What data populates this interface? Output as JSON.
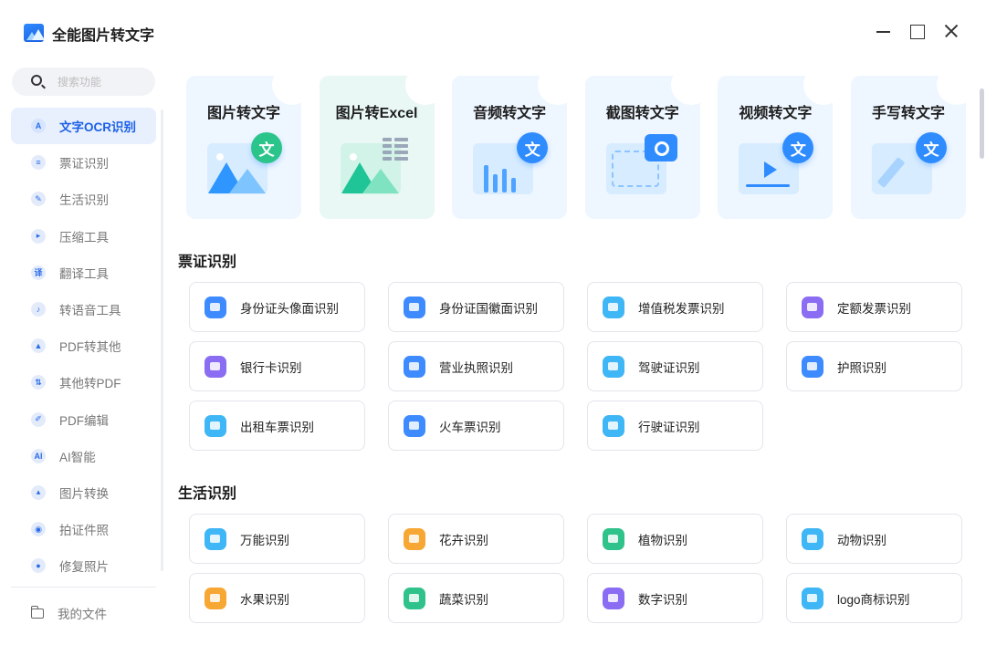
{
  "app": {
    "title": "全能图片转文字"
  },
  "search": {
    "placeholder": "搜索功能"
  },
  "sidebar": {
    "items": [
      {
        "label": "文字OCR识别",
        "icon": "A",
        "active": true
      },
      {
        "label": "票证识别",
        "icon": "≡"
      },
      {
        "label": "生活识别",
        "icon": "✎"
      },
      {
        "label": "压缩工具",
        "icon": "▸"
      },
      {
        "label": "翻译工具",
        "icon": "译"
      },
      {
        "label": "转语音工具",
        "icon": "♪"
      },
      {
        "label": "PDF转其他",
        "icon": "▲"
      },
      {
        "label": "其他转PDF",
        "icon": "⇅"
      },
      {
        "label": "PDF编辑",
        "icon": "✐"
      },
      {
        "label": "AI智能",
        "icon": "AI"
      },
      {
        "label": "图片转换",
        "icon": "▴"
      },
      {
        "label": "拍证件照",
        "icon": "◉"
      },
      {
        "label": "修复照片",
        "icon": "●"
      }
    ],
    "my_files": "我的文件"
  },
  "big_cards": [
    {
      "title": "图片转文字",
      "badge": "文"
    },
    {
      "title": "图片转Excel"
    },
    {
      "title": "音频转文字",
      "badge": "文"
    },
    {
      "title": "截图转文字"
    },
    {
      "title": "视频转文字",
      "badge": "文"
    },
    {
      "title": "手写转文字",
      "badge": "文"
    }
  ],
  "sections": [
    {
      "title": "票证识别",
      "items": [
        {
          "label": "身份证头像面识别",
          "color": "#3d8bff"
        },
        {
          "label": "身份证国徽面识别",
          "color": "#3d8bff"
        },
        {
          "label": "增值税发票识别",
          "color": "#3fb6f5"
        },
        {
          "label": "定额发票识别",
          "color": "#8a6df2"
        },
        {
          "label": "银行卡识别",
          "color": "#8a6df2"
        },
        {
          "label": "营业执照识别",
          "color": "#3d8bff"
        },
        {
          "label": "驾驶证识别",
          "color": "#3fb6f5"
        },
        {
          "label": "护照识别",
          "color": "#3d8bff"
        },
        {
          "label": "出租车票识别",
          "color": "#3fb6f5"
        },
        {
          "label": "火车票识别",
          "color": "#3d8bff"
        },
        {
          "label": "行驶证识别",
          "color": "#3fb6f5"
        }
      ]
    },
    {
      "title": "生活识别",
      "items": [
        {
          "label": "万能识别",
          "color": "#3fb6f5"
        },
        {
          "label": "花卉识别",
          "color": "#f7a733"
        },
        {
          "label": "植物识别",
          "color": "#2fc28a"
        },
        {
          "label": "动物识别",
          "color": "#3fb6f5"
        },
        {
          "label": "水果识别",
          "color": "#f7a733"
        },
        {
          "label": "蔬菜识别",
          "color": "#2fc28a"
        },
        {
          "label": "数字识别",
          "color": "#8a6df2"
        },
        {
          "label": "logo商标识别",
          "color": "#3fb6f5"
        }
      ]
    }
  ]
}
